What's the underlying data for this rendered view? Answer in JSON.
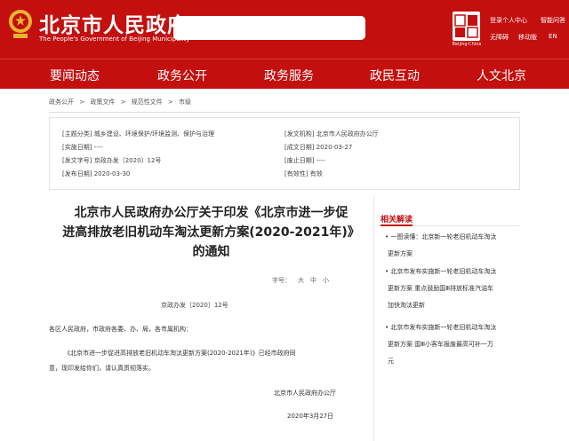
{
  "header": {
    "site_title": "北京市人民政府",
    "site_subtitle": "The People's Government of Beijing Municipality",
    "seal_caption": "Beijing·China",
    "links": {
      "login": "登录个人中心",
      "assist": "智能问答",
      "wireless": "无障碍",
      "mobile": "移动版",
      "lang": "EN"
    }
  },
  "nav": {
    "items": [
      "要闻动态",
      "政务公开",
      "政务服务",
      "政民互动",
      "人文北京"
    ]
  },
  "breadcrumb": [
    "政务公开",
    ">",
    "政策文件",
    ">",
    "规范性文件",
    ">",
    "市级"
  ],
  "meta": {
    "topic_key": "[主题分类]",
    "topic_val": "城乡建设、环境保护/环境监测、保护与治理",
    "issuer_key": "[发文机构]",
    "issuer_val": "北京市人民政府办公厅",
    "impl_key": "[实施日期]",
    "impl_val": "----",
    "made_key": "[成文日期]",
    "made_val": "2020-03-27",
    "docno_key": "[发文字号]",
    "docno_val": "京政办发〔2020〕12号",
    "abolish_key": "[废止日期]",
    "abolish_val": "----",
    "pub_key": "[发布日期]",
    "pub_val": "2020-03-30",
    "valid_key": "[有效性]",
    "valid_val": "有效"
  },
  "article": {
    "title_lines": [
      "北京市人民政府办公厅关于印发《北京市进一步促",
      "进高排放老旧机动车淘汰更新方案(2020-2021年)》",
      "的通知"
    ],
    "fontsize_label": "字号：",
    "fontsize_large": "大",
    "fontsize_mid": "中",
    "fontsize_small": "小",
    "doc_no": "京政办发〔2020〕12号",
    "salutation": "各区人民政府，市政府各委、办、局，各市属机构：",
    "body_1": "《北京市进一步促进高排放老旧机动车淘汰更新方案(2020-2021年)》已经市政府同",
    "body_2": "意，现印发给你们，请认真贯彻落实。",
    "signature": "北京市人民政府办公厅",
    "date": "2020年3月27日"
  },
  "related": {
    "heading": "相关解读",
    "items": [
      [
        "• 一图读懂：北京新一轮老旧机动车淘汰",
        "更新方案"
      ],
      [
        "• 北京市发布实施新一轮老旧机动车淘汰",
        "更新方案 重点鼓励国Ⅲ排放标准汽油车",
        "加快淘汰更新"
      ],
      [
        "• 北京市发布实施新一轮老旧机动车淘汰",
        "更新方案 国Ⅲ小客车报废最高可补一万",
        "元"
      ]
    ]
  },
  "colors": {
    "brand_red": "#c40f0f"
  }
}
